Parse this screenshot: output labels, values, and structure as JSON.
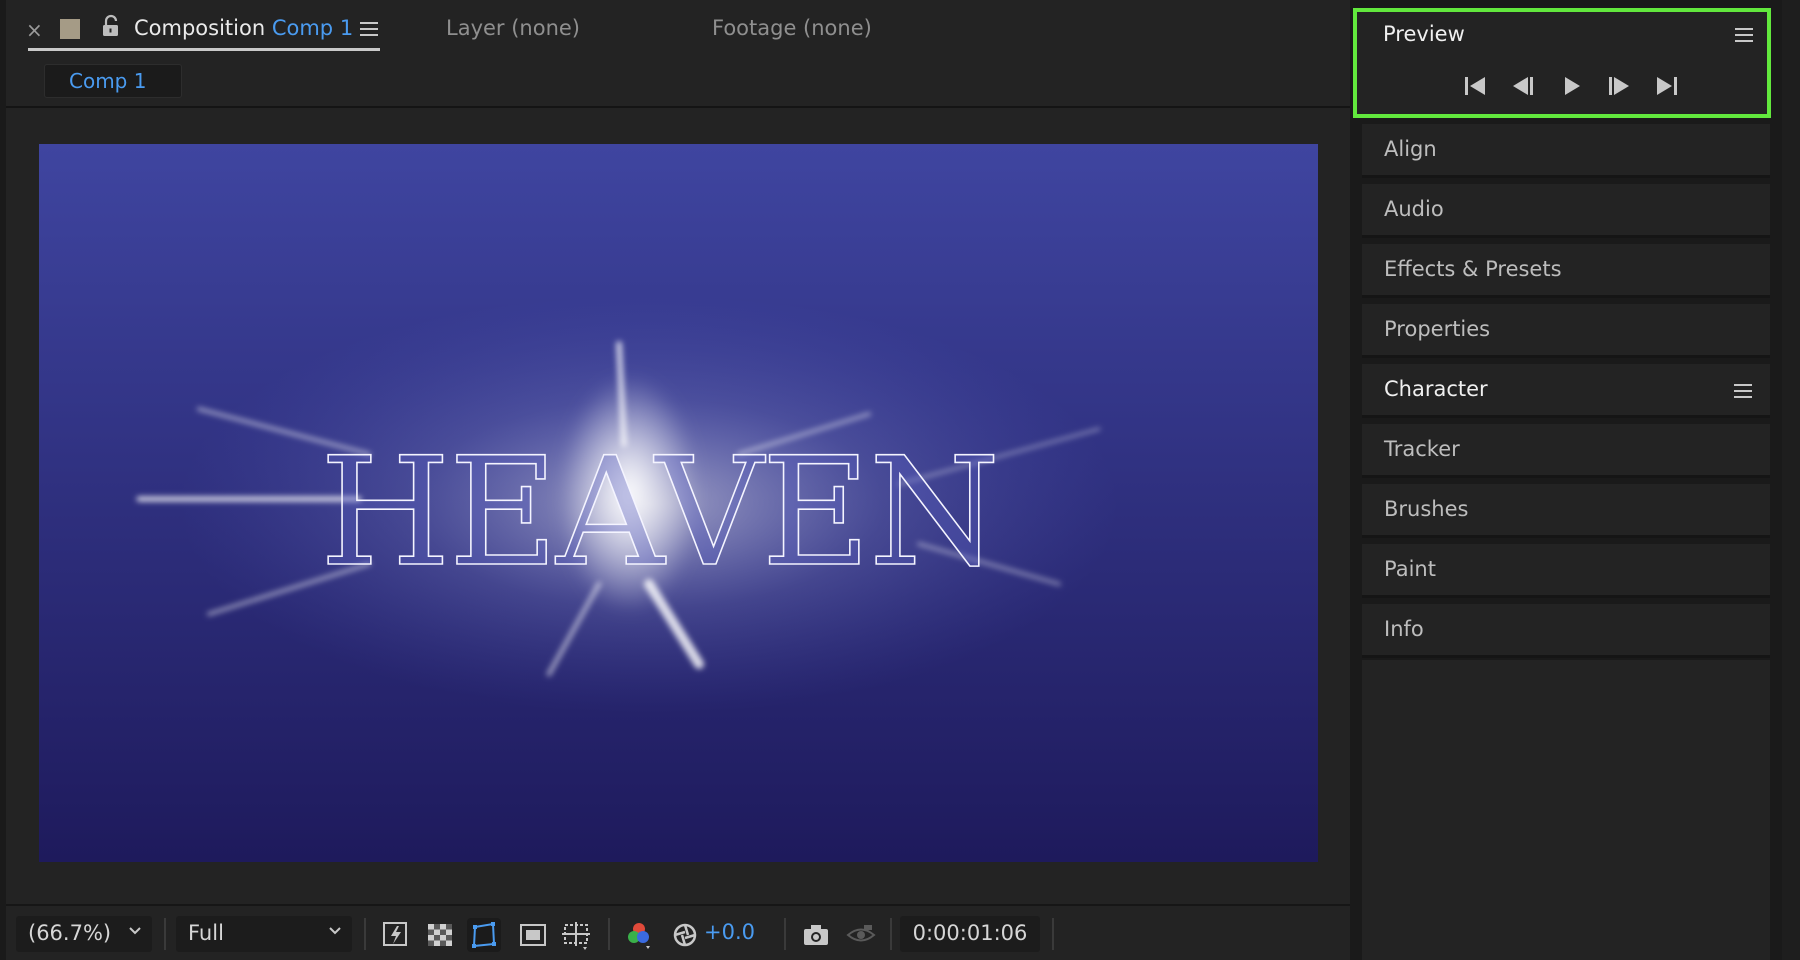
{
  "composition_tab": {
    "title_prefix": "Composition",
    "comp_name": "Comp 1",
    "subtab_label": "Comp 1"
  },
  "other_tabs": {
    "layer": "Layer (none)",
    "footage": "Footage (none)"
  },
  "viewer": {
    "text": "HEAVEN",
    "gradient_top": "#3f45a0",
    "gradient_bottom": "#1e1a5c"
  },
  "toolbar": {
    "magnification": "(66.7%)",
    "resolution": "Full",
    "exposure": "+0.0",
    "current_time": "0:00:01:06"
  },
  "preview_panel": {
    "title": "Preview",
    "highlight_color": "#62e83d",
    "controls": [
      "first-frame-icon",
      "previous-frame-icon",
      "play-icon",
      "next-frame-icon",
      "last-frame-icon"
    ]
  },
  "side_panels": [
    {
      "label": "Align"
    },
    {
      "label": "Audio"
    },
    {
      "label": "Effects & Presets"
    },
    {
      "label": "Properties"
    },
    {
      "label": "Character"
    },
    {
      "label": "Tracker"
    },
    {
      "label": "Brushes"
    },
    {
      "label": "Paint"
    },
    {
      "label": "Info"
    }
  ],
  "colors": {
    "accent_blue": "#4a9bf0",
    "panel_bg": "#232323"
  }
}
